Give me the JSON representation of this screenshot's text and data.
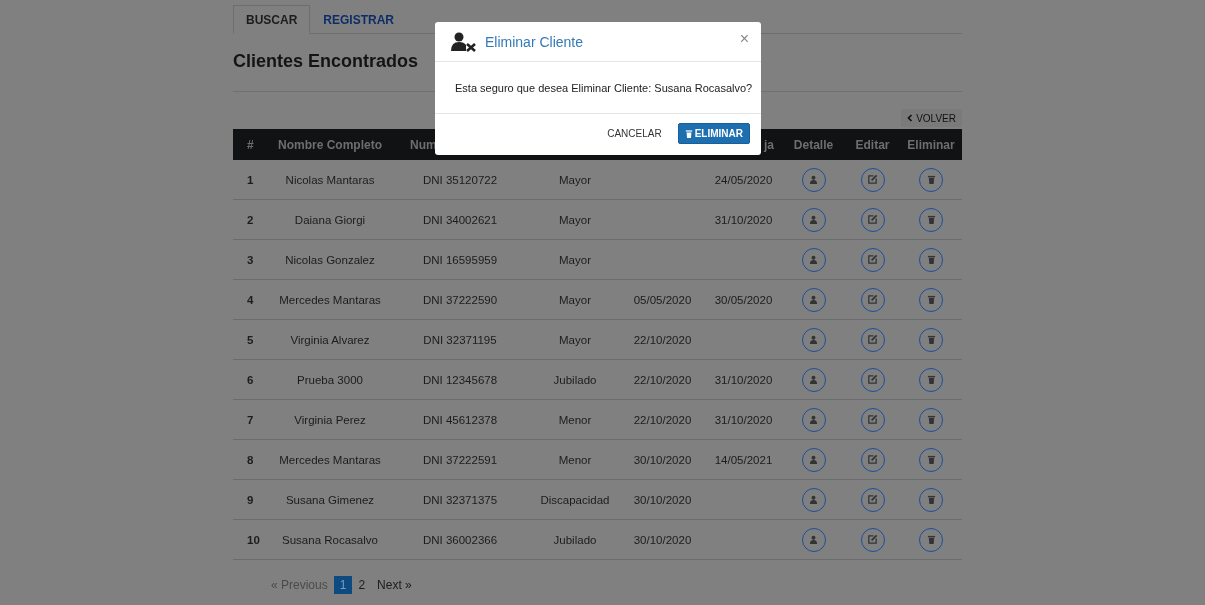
{
  "tabs": [
    {
      "label": "BUSCAR",
      "selected": true
    },
    {
      "label": "REGISTRAR",
      "selected": false
    }
  ],
  "title": "Clientes Encontrados",
  "back_button": "VOLVER",
  "table": {
    "columns": [
      {
        "label": "#"
      },
      {
        "label": "Nombre Completo"
      },
      {
        "label": "Num"
      },
      {},
      {},
      {
        "label": "ja"
      },
      {
        "label": "Detalle"
      },
      {
        "label": "Editar"
      },
      {
        "label": "Eliminar"
      }
    ],
    "rows": [
      {
        "n": "1",
        "name": "Nicolas Mantaras",
        "doc": "DNI 35120722",
        "category": "Mayor",
        "alta": "",
        "baja": "24/05/2020"
      },
      {
        "n": "2",
        "name": "Daiana Giorgi",
        "doc": "DNI 34002621",
        "category": "Mayor",
        "baja": "31/10/2020"
      },
      {
        "n": "3",
        "name": "Nicolas Gonzalez",
        "doc": "DNI 16595959",
        "category": "Mayor"
      },
      {
        "n": "4",
        "name": "Mercedes Mantaras",
        "doc": "DNI 37222590",
        "category": "Mayor",
        "alta": "05/05/2020",
        "baja": "30/05/2020"
      },
      {
        "n": "5",
        "name": "Virginia Alvarez",
        "doc": "DNI 32371195",
        "category": "Mayor",
        "alta": "22/10/2020"
      },
      {
        "n": "6",
        "name": "Prueba 3000",
        "doc": "DNI 12345678",
        "category": "Jubilado",
        "alta": "22/10/2020",
        "baja": "31/10/2020"
      },
      {
        "n": "7",
        "name": "Virginia Perez",
        "doc": "DNI 45612378",
        "category": "Menor",
        "alta": "22/10/2020",
        "baja": "31/10/2020"
      },
      {
        "n": "8",
        "name": "Mercedes Mantaras",
        "doc": "DNI 37222591",
        "category": "Menor",
        "alta": "30/10/2020",
        "baja": "14/05/2021"
      },
      {
        "n": "9",
        "name": "Susana Gimenez",
        "doc": "DNI 32371375",
        "category": "Discapacidad",
        "alta": "30/10/2020"
      },
      {
        "n": "10",
        "name": "Susana Rocasalvo",
        "doc": "DNI 36002366",
        "category": "Jubilado",
        "alta": "30/10/2020"
      }
    ]
  },
  "pagination": {
    "previous": "« Previous",
    "pages": [
      {
        "label": "1",
        "selected": true
      },
      {
        "label": "2",
        "selected": false
      }
    ],
    "next": "Next »"
  },
  "modal": {
    "title": "Eliminar Cliente",
    "close": "×",
    "message": "Esta seguro que desea Eliminar Cliente: Susana Rocasalvo?",
    "cancel": "CANCELAR",
    "confirm": "ELIMINAR"
  }
}
